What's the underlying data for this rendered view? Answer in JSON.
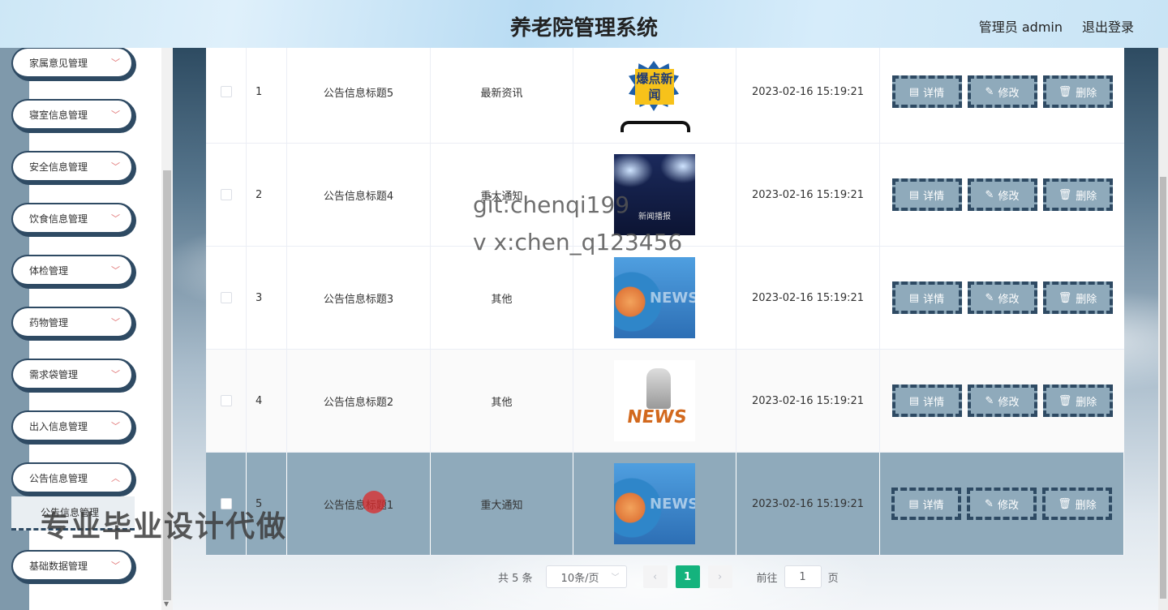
{
  "header": {
    "title": "养老院管理系统",
    "user": "管理员 admin",
    "logout": "退出登录"
  },
  "sidebar": {
    "items": [
      {
        "label": "家属意见管理",
        "icon": "chevron-down-icon"
      },
      {
        "label": "寝室信息管理",
        "icon": "chevron-down-icon"
      },
      {
        "label": "安全信息管理",
        "icon": "chevron-down-icon"
      },
      {
        "label": "饮食信息管理",
        "icon": "chevron-down-icon"
      },
      {
        "label": "体检管理",
        "icon": "chevron-down-icon"
      },
      {
        "label": "药物管理",
        "icon": "chevron-down-icon"
      },
      {
        "label": "需求袋管理",
        "icon": "chevron-down-icon"
      },
      {
        "label": "出入信息管理",
        "icon": "chevron-down-icon"
      },
      {
        "label": "公告信息管理",
        "icon": "chevron-down-icon"
      },
      {
        "label": "基础数据管理",
        "icon": "chevron-down-icon"
      }
    ],
    "sub_item": "公告信息管理"
  },
  "table": {
    "rows": [
      {
        "index": "1",
        "title": "公告信息标题5",
        "type": "最新资讯",
        "image": "爆点新闻",
        "time": "2023-02-16 15:19:21"
      },
      {
        "index": "2",
        "title": "公告信息标题4",
        "type": "重大通知",
        "image": "新闻播报",
        "time": "2023-02-16 15:19:21"
      },
      {
        "index": "3",
        "title": "公告信息标题3",
        "type": "其他",
        "image": "NEWS",
        "time": "2023-02-16 15:19:21"
      },
      {
        "index": "4",
        "title": "公告信息标题2",
        "type": "其他",
        "image": "NEWS",
        "time": "2023-02-16 15:19:21"
      },
      {
        "index": "5",
        "title": "公告信息标题1",
        "type": "重大通知",
        "image": "NEWS",
        "time": "2023-02-16 15:19:21"
      }
    ],
    "actions": {
      "detail": "详情",
      "edit": "修改",
      "delete": "删除"
    }
  },
  "pager": {
    "total": "共 5 条",
    "page_size": "10条/页",
    "current": "1",
    "jump_prefix": "前往",
    "jump_value": "1",
    "jump_suffix": "页"
  },
  "watermarks": {
    "line1": "git:chenqi199",
    "line2": "v x:chen_q123456",
    "line3": "专业毕业设计代做"
  },
  "colors": {
    "accent": "#14b37d",
    "selected_row": "#8faabb",
    "button_border": "#2e4a63"
  }
}
